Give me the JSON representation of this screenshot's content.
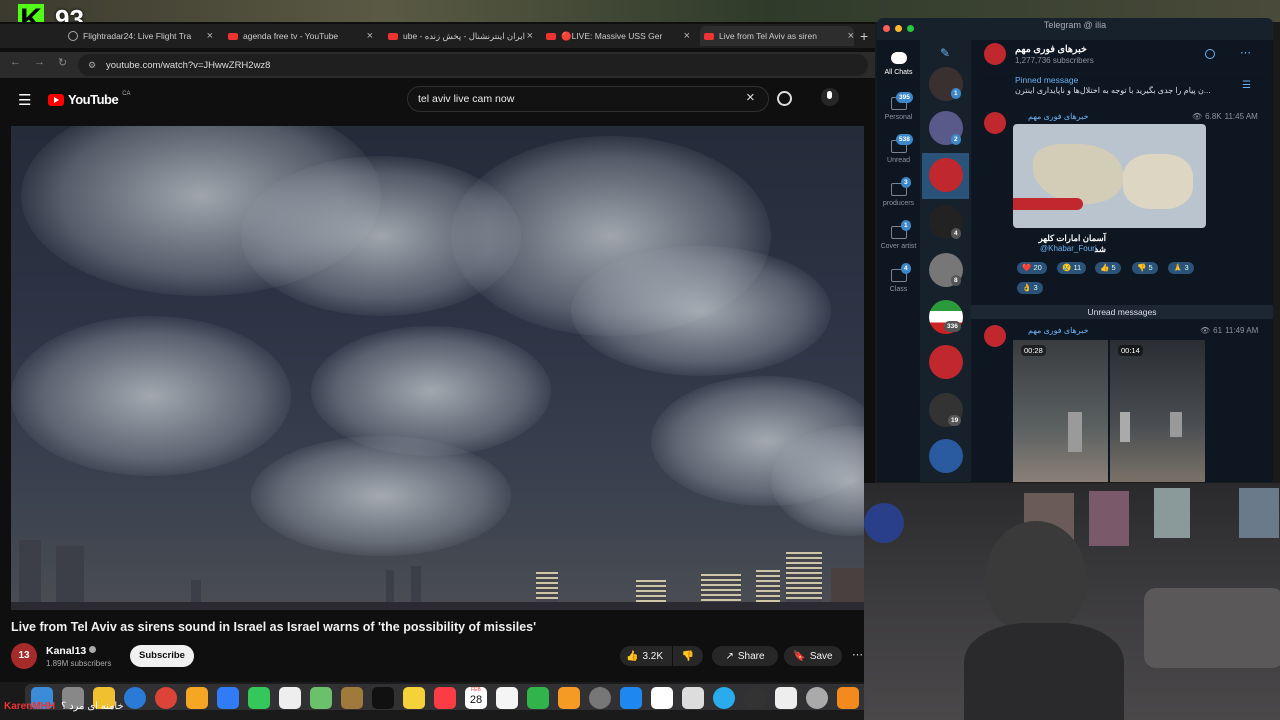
{
  "overlay": {
    "channel_logo": "K",
    "count": "93",
    "chat_line": "خامنه ای مرد ؟",
    "chat_user": "KarenMHH"
  },
  "browser": {
    "tabs": [
      {
        "label": "Flightradar24: Live Flight Tra",
        "icon": "globe-icon"
      },
      {
        "label": "agenda free tv - YouTube",
        "icon": "youtube-icon"
      },
      {
        "label": "ube - ایران اینترنشنال - پخش زنده",
        "icon": "youtube-icon"
      },
      {
        "label": "🔴LIVE: Massive USS Ger",
        "icon": "youtube-icon"
      },
      {
        "label": "Live from Tel Aviv as siren",
        "icon": "youtube-icon"
      }
    ],
    "url": "youtube.com/watch?v=JHwwZRH2wz8"
  },
  "youtube": {
    "logo": "YouTube",
    "region": "CA",
    "search_value": "tel aviv live cam now",
    "video_title": "Live from Tel Aviv as sirens sound in Israel as Israel warns of 'the possibility of missiles'",
    "channel_name": "Kanal13",
    "channel_avatar": "13",
    "subscribers": "1.89M subscribers",
    "subscribe_label": "Subscribe",
    "likes": "3.2K",
    "share_label": "Share",
    "save_label": "Save"
  },
  "telegram": {
    "window_title": "Telegram @ ilia",
    "folders": [
      {
        "label": "All Chats",
        "badge": ""
      },
      {
        "label": "Personal",
        "badge": "395"
      },
      {
        "label": "Unread",
        "badge": "538"
      },
      {
        "label": "producers",
        "badge": "3"
      },
      {
        "label": "Cover artist",
        "badge": "1"
      },
      {
        "label": "Class",
        "badge": "4"
      }
    ],
    "chat_badges": [
      "1",
      "2",
      "",
      "4",
      "8",
      "336",
      "",
      "19",
      ""
    ],
    "channel_title": "خبرهای فوری مهم",
    "channel_subs": "1,277,736 subscribers",
    "pinned_label": "Pinned message",
    "pinned_text": "ن پیام را جدی بگیرید با توجه به اختلال‌ها و ناپایداری اینترن...",
    "post1": {
      "author": "خبرهای فوری مهم",
      "views": "6.8K",
      "time": "11:45 AM",
      "caption": "آسمان امارات کلهر شد",
      "handle": "@Khabar_Fouri"
    },
    "reactions": [
      {
        "emoji": "❤️",
        "count": "20"
      },
      {
        "emoji": "😢",
        "count": "11"
      },
      {
        "emoji": "👍",
        "count": "5"
      },
      {
        "emoji": "👎",
        "count": "5"
      },
      {
        "emoji": "🙏",
        "count": "3"
      },
      {
        "emoji": "👌",
        "count": "3"
      }
    ],
    "unread_divider": "Unread messages",
    "post2": {
      "author": "خبرهای فوری مهم",
      "views": "61",
      "time": "11:49 AM",
      "video1": "00:28",
      "video2": "00:14"
    }
  },
  "dock": {
    "calendar_day": "28",
    "calendar_month": "FEB"
  }
}
